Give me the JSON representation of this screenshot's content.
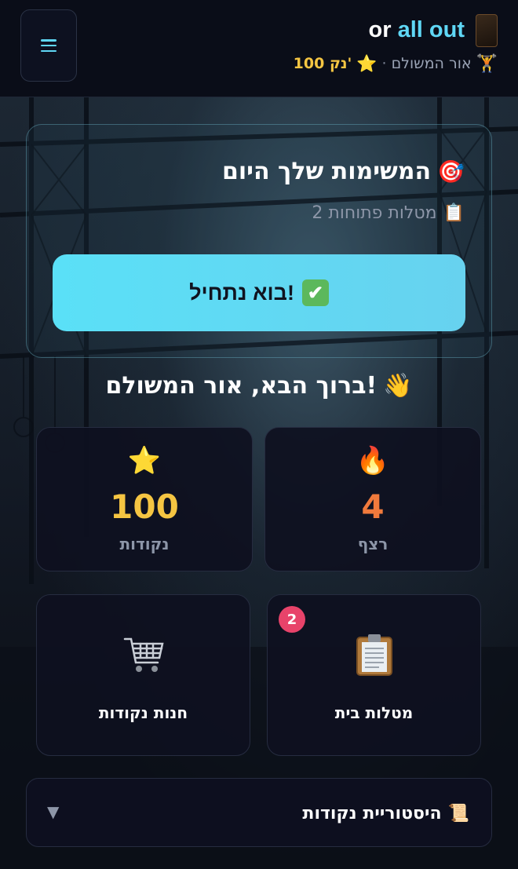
{
  "header": {
    "title_part1": "or",
    "title_part2": "all out",
    "user_name": "אור המשולם",
    "separator": "·",
    "points_label": "100 נק'",
    "menu_icon": "hamburger-icon",
    "logo_icon": "app-logo-icon",
    "lifter_icon": "🏋️",
    "star_icon": "⭐"
  },
  "tasks_card": {
    "title": "המשימות שלך היום",
    "title_icon": "🎯",
    "subtitle": "2 מטלות פתוחות",
    "subtitle_icon": "📋",
    "start_button": "בוא נתחיל!",
    "start_icon": "✔"
  },
  "welcome": {
    "text": "ברוך הבא, אור המשולם!",
    "icon": "👋"
  },
  "stats": {
    "streak": {
      "icon": "🔥",
      "value": "4",
      "label": "רצף"
    },
    "points": {
      "icon": "⭐",
      "value": "100",
      "label": "נקודות"
    }
  },
  "features": {
    "homework": {
      "label": "מטלות בית",
      "badge": "2",
      "icon": "clipboard-icon"
    },
    "shop": {
      "label": "חנות נקודות",
      "icon": "shopping-cart-icon"
    }
  },
  "history": {
    "title": "היסטוריית נקודות",
    "icon": "📜",
    "caret": "▼"
  },
  "colors": {
    "accent": "#5fd7f5",
    "points_gold": "#f5c542",
    "streak_orange": "#f07a3c",
    "badge_pink": "#e8436a",
    "background": "#0b0e1a"
  }
}
